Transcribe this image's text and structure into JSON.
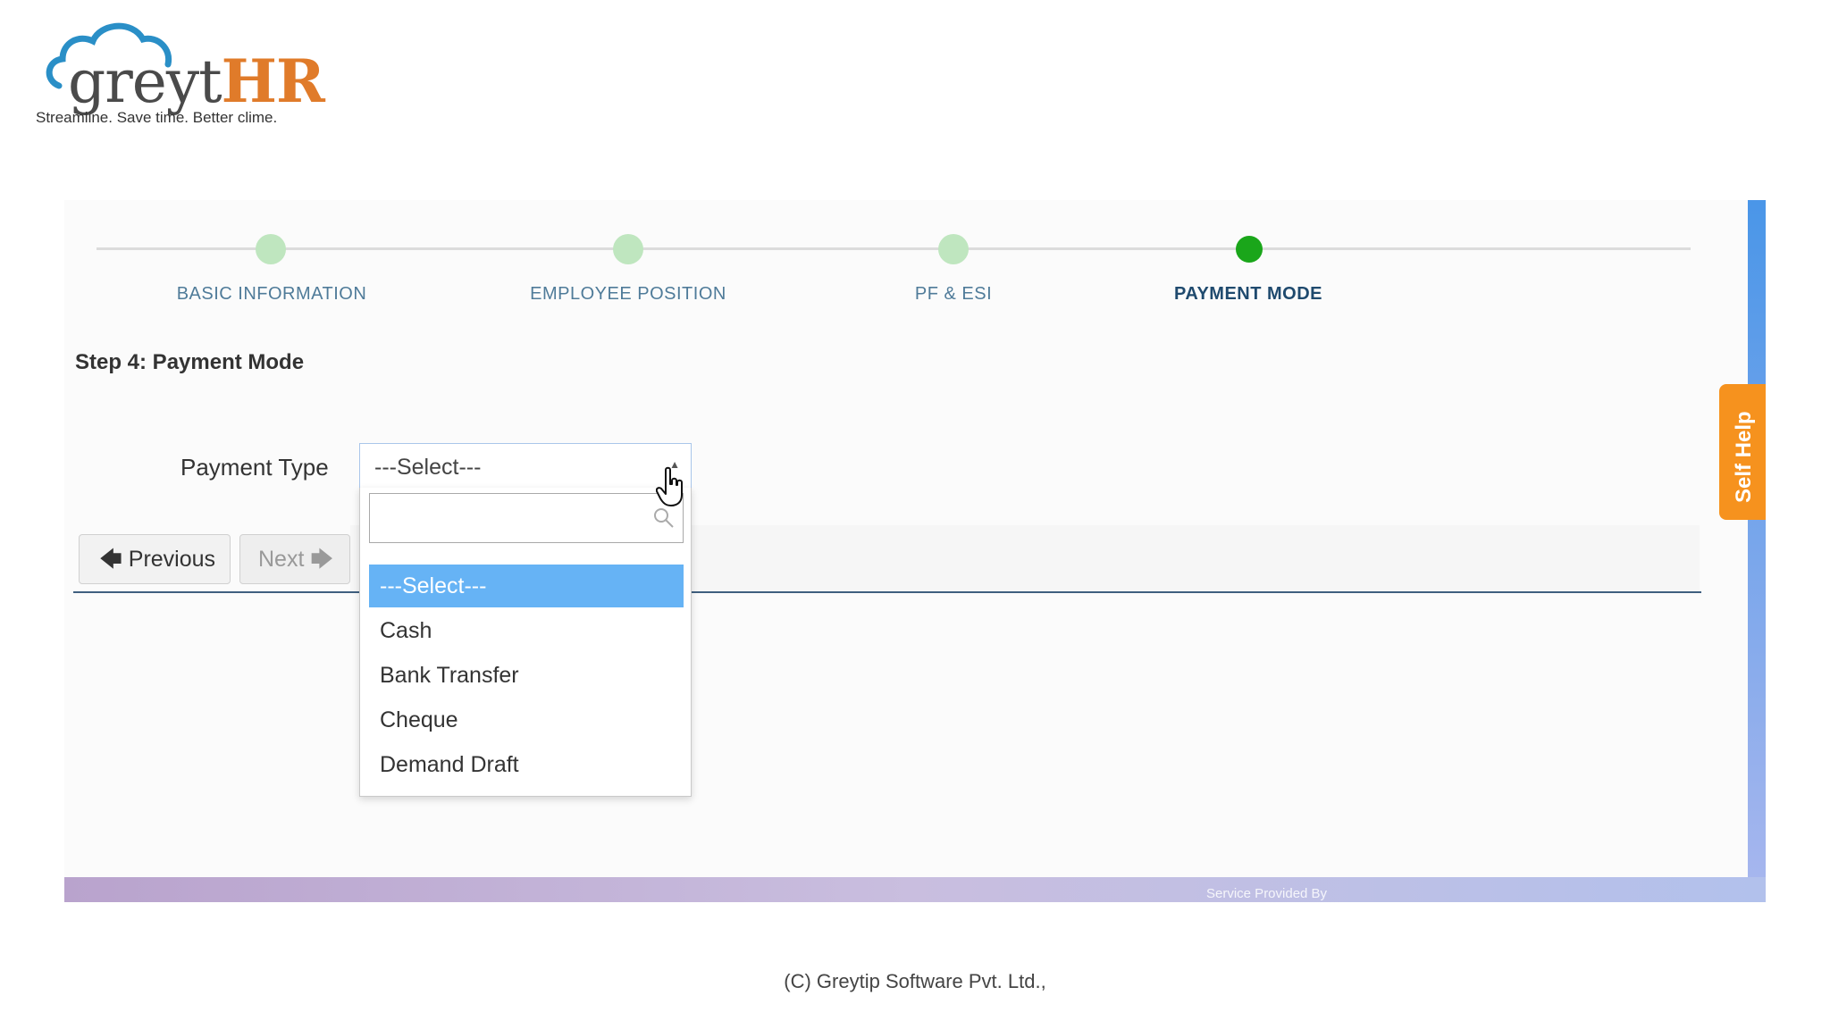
{
  "brand": {
    "logo_grey": "greyt",
    "logo_hr": "HR",
    "tagline": "Streamline. Save time. Better clime.",
    "cloud_color": "#2a8fc7",
    "hr_color": "#e07b2a"
  },
  "stepper": {
    "steps": [
      {
        "label": "BASIC INFORMATION",
        "state": "done"
      },
      {
        "label": "EMPLOYEE POSITION",
        "state": "done"
      },
      {
        "label": "PF & ESI",
        "state": "done"
      },
      {
        "label": "PAYMENT MODE",
        "state": "active"
      }
    ],
    "done_color": "#bfe6bf",
    "active_color": "#1aa61a"
  },
  "form": {
    "step_title": "Step 4: Payment Mode",
    "payment_type_label": "Payment Type",
    "payment_type_value": "---Select---",
    "search_placeholder": "",
    "options": [
      "---Select---",
      "Cash",
      "Bank Transfer",
      "Cheque",
      "Demand Draft"
    ],
    "selected_option": "---Select---"
  },
  "buttons": {
    "previous": "Previous",
    "next": "Next"
  },
  "self_help": "Self Help",
  "footer": {
    "service": "Service Provided By",
    "copyright": "(C) Greytip Software Pvt. Ltd.,"
  }
}
